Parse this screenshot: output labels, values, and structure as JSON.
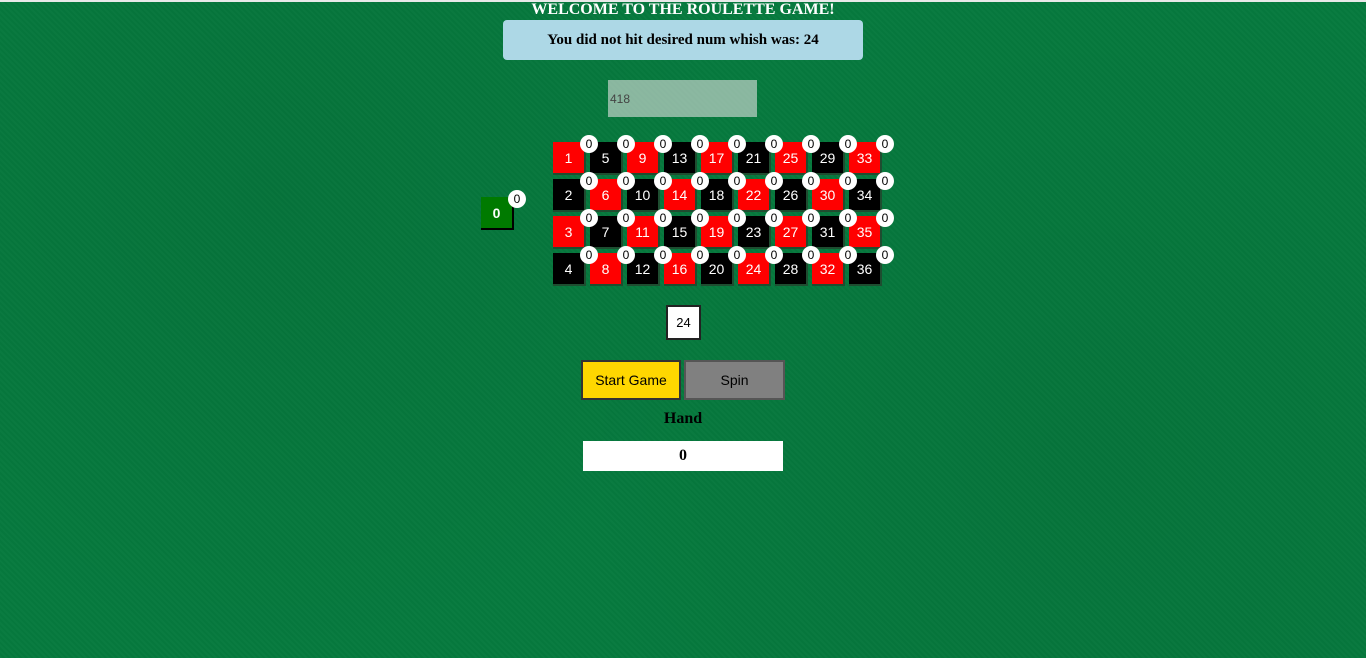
{
  "title": "WELCOME TO THE ROULETTE GAME!",
  "message": "You did not hit desired num whish was: 24",
  "bet_input": {
    "placeholder": "418"
  },
  "zero": {
    "number": "0",
    "color": "green",
    "chip": "0"
  },
  "board": [
    {
      "number": "1",
      "color": "red",
      "chip": "0"
    },
    {
      "number": "5",
      "color": "black",
      "chip": "0"
    },
    {
      "number": "9",
      "color": "red",
      "chip": "0"
    },
    {
      "number": "13",
      "color": "black",
      "chip": "0"
    },
    {
      "number": "17",
      "color": "red",
      "chip": "0"
    },
    {
      "number": "21",
      "color": "black",
      "chip": "0"
    },
    {
      "number": "25",
      "color": "red",
      "chip": "0"
    },
    {
      "number": "29",
      "color": "black",
      "chip": "0"
    },
    {
      "number": "33",
      "color": "red",
      "chip": "0"
    },
    {
      "number": "2",
      "color": "black",
      "chip": "0"
    },
    {
      "number": "6",
      "color": "red",
      "chip": "0"
    },
    {
      "number": "10",
      "color": "black",
      "chip": "0"
    },
    {
      "number": "14",
      "color": "red",
      "chip": "0"
    },
    {
      "number": "18",
      "color": "black",
      "chip": "0"
    },
    {
      "number": "22",
      "color": "red",
      "chip": "0"
    },
    {
      "number": "26",
      "color": "black",
      "chip": "0"
    },
    {
      "number": "30",
      "color": "red",
      "chip": "0"
    },
    {
      "number": "34",
      "color": "black",
      "chip": "0"
    },
    {
      "number": "3",
      "color": "red",
      "chip": "0"
    },
    {
      "number": "7",
      "color": "black",
      "chip": "0"
    },
    {
      "number": "11",
      "color": "red",
      "chip": "0"
    },
    {
      "number": "15",
      "color": "black",
      "chip": "0"
    },
    {
      "number": "19",
      "color": "red",
      "chip": "0"
    },
    {
      "number": "23",
      "color": "black",
      "chip": "0"
    },
    {
      "number": "27",
      "color": "red",
      "chip": "0"
    },
    {
      "number": "31",
      "color": "black",
      "chip": "0"
    },
    {
      "number": "35",
      "color": "red",
      "chip": "0"
    },
    {
      "number": "4",
      "color": "black",
      "chip": "0"
    },
    {
      "number": "8",
      "color": "red",
      "chip": "0"
    },
    {
      "number": "12",
      "color": "black",
      "chip": "0"
    },
    {
      "number": "16",
      "color": "red",
      "chip": "0"
    },
    {
      "number": "20",
      "color": "black",
      "chip": "0"
    },
    {
      "number": "24",
      "color": "red",
      "chip": "0"
    },
    {
      "number": "28",
      "color": "black",
      "chip": "0"
    },
    {
      "number": "32",
      "color": "red",
      "chip": "0"
    },
    {
      "number": "36",
      "color": "black",
      "chip": "0"
    }
  ],
  "result": "24",
  "buttons": {
    "start": "Start Game",
    "spin": "Spin"
  },
  "hand": {
    "label": "Hand",
    "value": "0"
  },
  "colors": {
    "table_green": "#067a3e",
    "red": "#ff0000",
    "black": "#000000",
    "zero_green": "#007a00",
    "message_bg": "#add8e6",
    "start_button": "#ffd700",
    "spin_button": "#808080"
  }
}
